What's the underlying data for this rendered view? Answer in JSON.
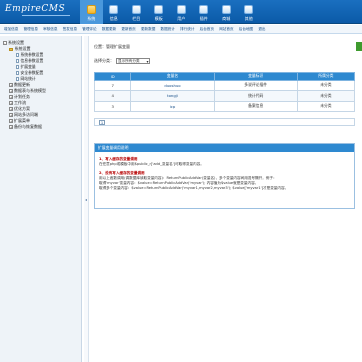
{
  "header": {
    "logo": "EmpireCMS",
    "nav": [
      {
        "label": "系统",
        "active": true
      },
      {
        "label": "信息",
        "active": false
      },
      {
        "label": "栏目",
        "active": false
      },
      {
        "label": "模板",
        "active": false
      },
      {
        "label": "用户",
        "active": false
      },
      {
        "label": "插件",
        "active": false
      },
      {
        "label": "商城",
        "active": false
      },
      {
        "label": "其他",
        "active": false
      }
    ]
  },
  "subnav": [
    "增加信息",
    "管理信息",
    "审核信息",
    "签发信息",
    "管理评论",
    "数据更新",
    "更新首页",
    "更新数据",
    "数据统计",
    "排行统计",
    "后台首页",
    "网站首页",
    "后台地图",
    "退出"
  ],
  "sidebar": {
    "tree": [
      {
        "label": "系统设置",
        "level": 1,
        "type": "box",
        "mark": "-"
      },
      {
        "label": "系统设置",
        "level": 2,
        "type": "folder"
      },
      {
        "label": "系统参数设置",
        "level": 3,
        "type": "page"
      },
      {
        "label": "信息参数设置",
        "level": 3,
        "type": "page"
      },
      {
        "label": "扩展变量",
        "level": 3,
        "type": "page"
      },
      {
        "label": "安全参数配置",
        "level": 3,
        "type": "page"
      },
      {
        "label": "网站统计",
        "level": 3,
        "type": "page"
      },
      {
        "label": "数据更新",
        "level": 2,
        "type": "box",
        "mark": "+"
      },
      {
        "label": "数据表与系统模型",
        "level": 2,
        "type": "box",
        "mark": "+"
      },
      {
        "label": "计划任务",
        "level": 2,
        "type": "box",
        "mark": "+"
      },
      {
        "label": "工作流",
        "level": 2,
        "type": "box",
        "mark": "+"
      },
      {
        "label": "优化方案",
        "level": 2,
        "type": "box",
        "mark": "+"
      },
      {
        "label": "网站多访问端",
        "level": 2,
        "type": "box",
        "mark": "+"
      },
      {
        "label": "扩展菜单",
        "level": 2,
        "type": "box",
        "mark": "+"
      },
      {
        "label": "备份与恢复数据",
        "level": 2,
        "type": "box",
        "mark": "+"
      }
    ],
    "splitter_arrow": "◂"
  },
  "main": {
    "breadcrumb": "位置：管理扩展变量",
    "filter_label": "选择分类：",
    "filter_value": "显示所有分类",
    "columns": [
      "ID",
      "变量名",
      "变量标识",
      "所属分类"
    ],
    "rows": [
      {
        "id": "7",
        "name": "duoshuo",
        "label": "多说评论插件",
        "category": "未分类"
      },
      {
        "id": "4",
        "name": "tongji",
        "label": "统计代码",
        "category": "未分类"
      },
      {
        "id": "3",
        "name": "icp",
        "label": "备案信息",
        "category": "未分类"
      }
    ],
    "page": "1",
    "help": {
      "title": "扩展变量调用说明",
      "h1": "1、写入缓存的变量调用",
      "p1": "在任意php或模板中用$public_r['add_变量名']可取得变量内容。",
      "h2": "2、没有写入缓存的变量调用",
      "p2": "用以上函数调用(调数据库读取变量内容)：ReturnPublicAddVar(变量名)，多个变量内容间用逗号隔开，例子：",
      "p3": "取得'myvar'变量内容：$value=ReturnPublicAddVar('myvar'); 内容值为$value就是变量内容。",
      "p4": "取得多个变量内容：$value=ReturnPublicAddVar('myvar1,myvar2,myvar3'); $value['myvar1']才是变量内容。"
    }
  },
  "colors": {
    "header": "#0b5aa7",
    "table_header": "#2e89d0",
    "help_heading": "#b60000",
    "green": "#3e9b2e"
  }
}
